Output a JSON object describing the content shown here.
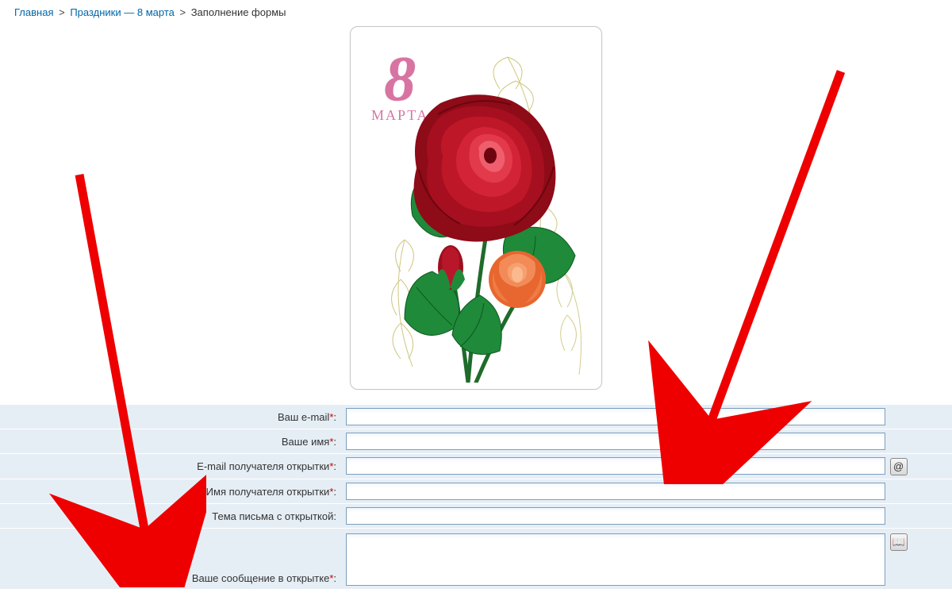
{
  "breadcrumb": {
    "home": "Главная",
    "category": "Праздники — 8 марта",
    "current": "Заполнение формы"
  },
  "card": {
    "digit": "8",
    "word": "МАРТА"
  },
  "form": {
    "email_label": "Ваш e-mail",
    "name_label": "Ваше имя",
    "recipient_email_label": "E-mail получателя открытки",
    "recipient_name_label": "Имя получателя открытки",
    "subject_label": "Тема письма с открыткой",
    "message_label": "Ваше сообщение в открытке",
    "colon": ":",
    "email_value": "",
    "name_value": "",
    "recipient_email_value": "",
    "recipient_name_value": "",
    "subject_value": "",
    "message_value": ""
  },
  "icons": {
    "address_book": "@",
    "poem_book": "📖"
  }
}
